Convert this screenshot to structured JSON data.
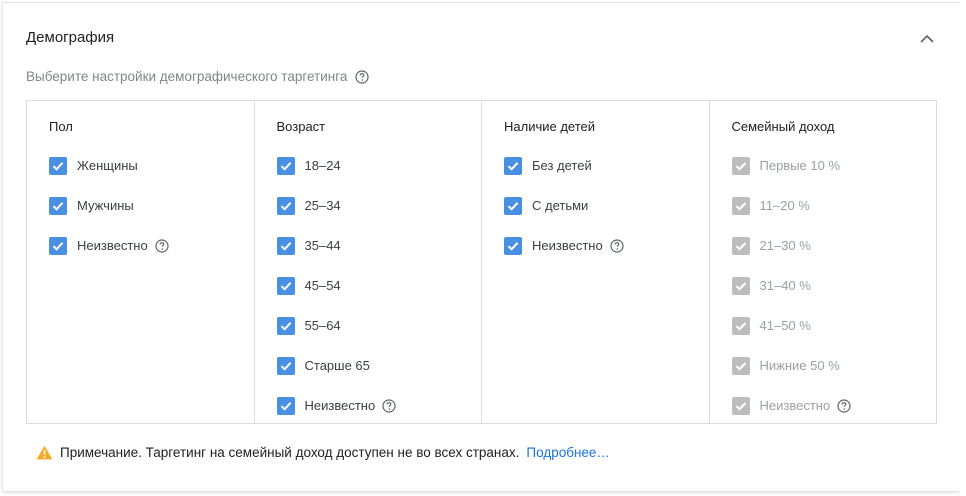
{
  "header": {
    "title": "Демография"
  },
  "subtitle": "Выберите настройки демографического таргетинга",
  "columns": [
    {
      "title": "Пол",
      "options": [
        {
          "label": "Женщины",
          "checked": true
        },
        {
          "label": "Мужчины",
          "checked": true
        },
        {
          "label": "Неизвестно",
          "checked": true,
          "help": true
        }
      ]
    },
    {
      "title": "Возраст",
      "options": [
        {
          "label": "18–24",
          "checked": true
        },
        {
          "label": "25–34",
          "checked": true
        },
        {
          "label": "35–44",
          "checked": true
        },
        {
          "label": "45–54",
          "checked": true
        },
        {
          "label": "55–64",
          "checked": true
        },
        {
          "label": "Старше 65",
          "checked": true
        },
        {
          "label": "Неизвестно",
          "checked": true,
          "help": true
        }
      ]
    },
    {
      "title": "Наличие детей",
      "options": [
        {
          "label": "Без детей",
          "checked": true
        },
        {
          "label": "С детьми",
          "checked": true
        },
        {
          "label": "Неизвестно",
          "checked": true,
          "help": true
        }
      ]
    },
    {
      "title": "Семейный доход",
      "disabled": true,
      "options": [
        {
          "label": "Первые 10 %",
          "checked": true
        },
        {
          "label": "11–20 %",
          "checked": true
        },
        {
          "label": "21–30 %",
          "checked": true
        },
        {
          "label": "31–40 %",
          "checked": true
        },
        {
          "label": "41–50 %",
          "checked": true
        },
        {
          "label": "Нижние 50 %",
          "checked": true
        },
        {
          "label": "Неизвестно",
          "checked": true,
          "help": true
        }
      ]
    }
  ],
  "note": {
    "text": "Примечание. Таргетинг на семейный доход доступен не во всех странах.",
    "link": "Подробнее…"
  },
  "colors": {
    "checkbox_active": "#4a90e2",
    "checkbox_disabled": "#bdbdbd",
    "link": "#1a73e8",
    "warning": "#f9a825"
  }
}
